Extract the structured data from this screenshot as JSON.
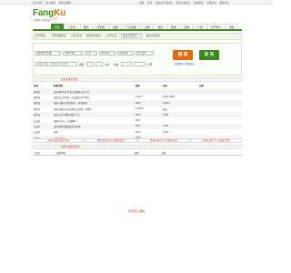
{
  "topbar": {
    "left": [
      "设为首页",
      "加入收藏",
      "我的房酷网"
    ],
    "right": [
      "注册",
      "登录",
      "看过的房源信息",
      "更多房源信息",
      "投诉建议",
      "注册会员",
      "帮助中心"
    ]
  },
  "logo": {
    "main": "Fang",
    "accent": "Ku",
    "domain": ".com",
    "sub": "房酷网 中国房地产"
  },
  "nav": [
    "首页",
    "二手房",
    "租房",
    "写字楼",
    "商铺",
    "厂房仓库",
    "土地",
    "新房",
    "装修",
    "建材",
    "广告",
    "房产中介",
    "交友"
  ],
  "hotbar": {
    "items": [
      "热门搜索：",
      "不同重要楼盘",
      "二手房信息",
      "最新重大楼盘",
      "二手房信息",
      "最新房源信息"
    ],
    "chip": "更多房源信息 >",
    "right": "最新房源信息"
  },
  "filters": {
    "row1": [
      {
        "label": "",
        "value": "选择类型(不限)"
      },
      {
        "label": "",
        "value": "不限(不限)"
      },
      {
        "label": "",
        "value": "户型"
      },
      {
        "label": "",
        "value": "单价区间"
      },
      {
        "label": "",
        "value": "房源范围"
      },
      {
        "label": "",
        "value": "房产类型"
      }
    ],
    "keyword_placeholder": "请输入楼盘、道路或者小区名称",
    "price_label": "面积",
    "price_unit": "平方",
    "area_label": "价格",
    "area_unit": "万/月",
    "search_button": "搜 索",
    "post_button": "发 布",
    "sub_links": "高级搜索 | 地图找房"
  },
  "section1": {
    "title": "石家庄租房信息",
    "columns": [
      "区域",
      "标题/地址",
      "面积",
      "价格",
      "日期"
    ],
    "rows": [
      [
        "桥西区",
        "出租 裕华区中华北大街紧临万达广场",
        "",
        "",
        ""
      ],
      [
        "桥西区",
        "出租 南二环中段（长安路以南300米）",
        "114m²",
        "2900-3300",
        ""
      ],
      [
        "桥西区",
        "出租 石家庄市区域住宅、商铺房源",
        "85m²",
        "1200-1",
        ""
      ],
      [
        "裕华区",
        "出租 石家庄市区高档住宅出租 三室两厅",
        "1243m²",
        "面议",
        ""
      ],
      [
        "裕华区",
        "出租 市中心繁华地段1个月",
        "82m²",
        "1400",
        ""
      ],
      [
        "长安区",
        "出租 市中心，交通便利",
        "80m²",
        "",
        ""
      ],
      [
        "长安区",
        "出租 繁华地段精品住宅房源",
        "76m²",
        "1300",
        ""
      ],
      [
        "长安区",
        "出租 ",
        "75m²",
        "1100",
        ""
      ],
      [
        "新华区",
        "出租 石家庄",
        "70m²",
        "",
        ""
      ],
      [
        "长安区",
        "出租 ",
        "",
        "",
        ""
      ]
    ]
  },
  "pagebar": [
    "[更多长安区租房信息]",
    "[更多石家庄中介出租房信息]",
    "[更多石家庄中介出租房信息]",
    "[更多石家庄个人出租房信息]"
  ],
  "section2": {
    "title": "石家庄出租房信息"
  },
  "resultbar": {
    "col1": "区 域",
    "col2": "标题/地址",
    "col3": "面积",
    "col4": "租金"
  },
  "empty_message": "该区域暂无数据！",
  "colors": {
    "green": "#3f8d1e",
    "orange": "#e46a0c",
    "link": "#1b59b0",
    "red": "#c0392b"
  }
}
